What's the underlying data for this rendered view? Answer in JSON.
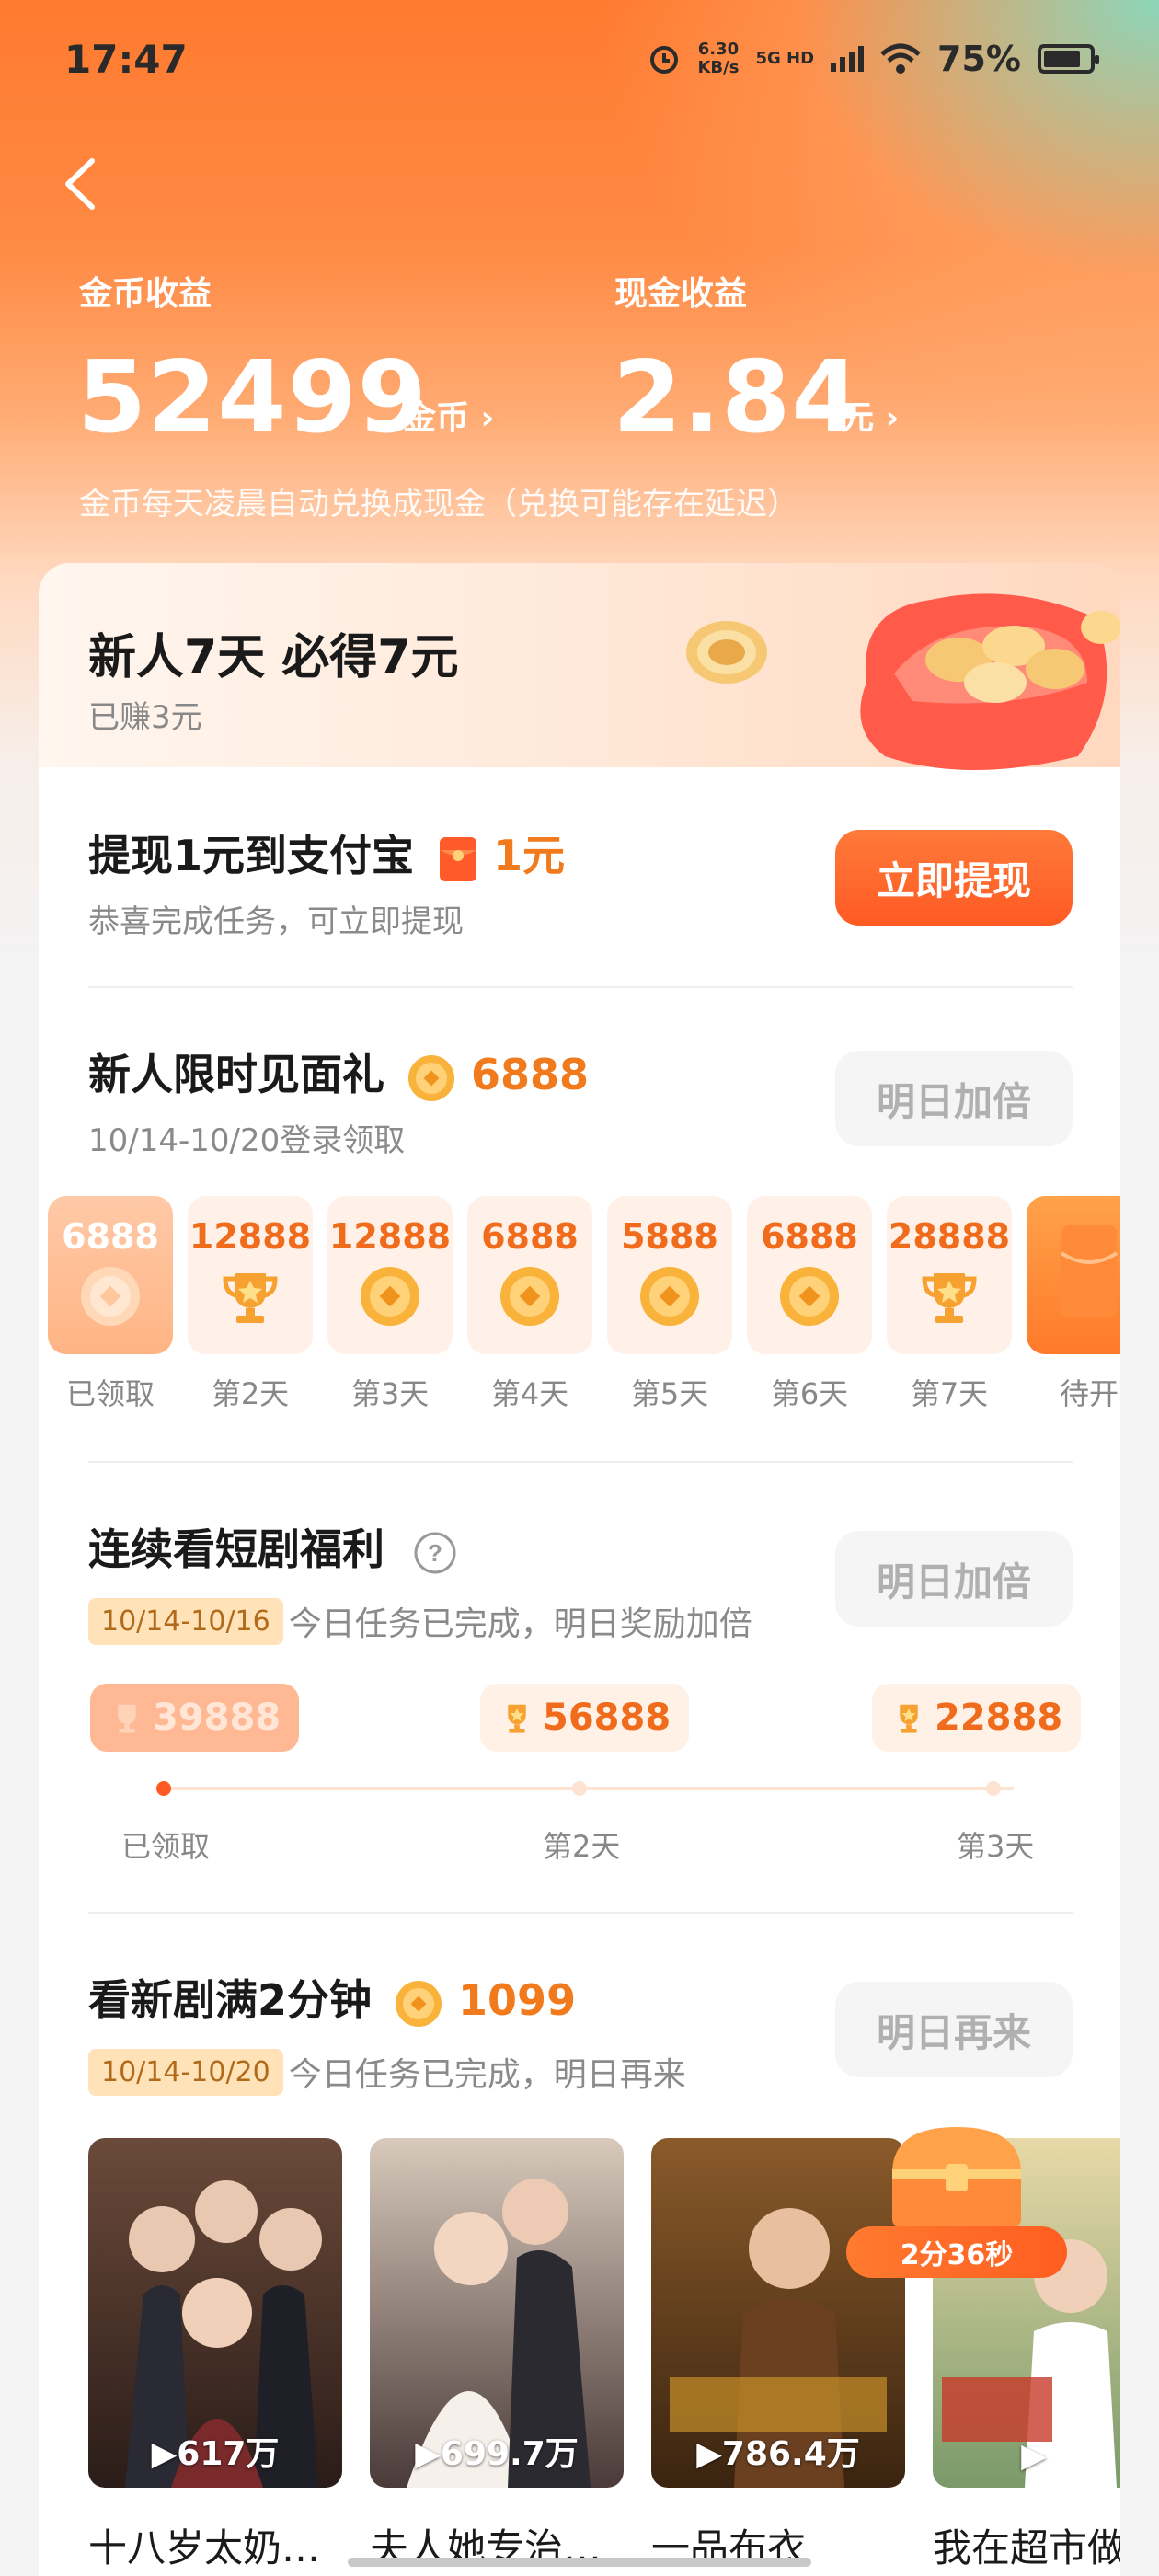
{
  "status_bar": {
    "time": "17:47",
    "speed_value": "6.30",
    "speed_unit": "KB/s",
    "network": "5G HD",
    "battery": "75%"
  },
  "header": {
    "coin_label": "金币收益",
    "coin_value": "52499",
    "coin_unit": "金币 ›",
    "cash_label": "现金收益",
    "cash_value": "2.84",
    "cash_unit": "元 ›",
    "note": "金币每天凌晨自动兑换成现金（兑换可能存在延迟）"
  },
  "banner": {
    "title": "新人7天 必得7元",
    "subtitle": "已赚3元"
  },
  "withdraw": {
    "title": "提现1元到支付宝",
    "amount": "1元",
    "subtitle": "恭喜完成任务，可立即提现",
    "button": "立即提现"
  },
  "gift": {
    "title": "新人限时见面礼",
    "coins": "6888",
    "subtitle": "10/14-10/20登录领取",
    "button": "明日加倍",
    "days": [
      {
        "value": "6888",
        "label": "已领取",
        "icon": "coin-icon",
        "state": "claimed"
      },
      {
        "value": "12888",
        "label": "第2天",
        "icon": "trophy-icon",
        "state": "pending"
      },
      {
        "value": "12888",
        "label": "第3天",
        "icon": "coin-icon",
        "state": "pending"
      },
      {
        "value": "6888",
        "label": "第4天",
        "icon": "coin-icon",
        "state": "pending"
      },
      {
        "value": "5888",
        "label": "第5天",
        "icon": "coin-icon",
        "state": "pending"
      },
      {
        "value": "6888",
        "label": "第6天",
        "icon": "coin-icon",
        "state": "pending"
      },
      {
        "value": "28888",
        "label": "第7天",
        "icon": "trophy-icon",
        "state": "pending"
      },
      {
        "value": "",
        "label": "待开",
        "icon": "red-packet-icon",
        "state": "locked"
      }
    ]
  },
  "streak": {
    "title": "连续看短剧福利",
    "date_tag": "10/14-10/16",
    "desc": "今日任务已完成，明日奖励加倍",
    "button": "明日加倍",
    "steps": [
      {
        "value": "39888",
        "label": "已领取"
      },
      {
        "value": "56888",
        "label": "第2天"
      },
      {
        "value": "22888",
        "label": "第3天"
      }
    ]
  },
  "watch": {
    "title": "看新剧满2分钟",
    "coins": "1099",
    "date_tag": "10/14-10/20",
    "desc": "今日任务已完成，明日再来",
    "button": "明日再来",
    "timer": "2分36秒",
    "dramas": [
      {
        "title": "十八岁太奶…",
        "views": "▶617万",
        "color_top": "#6b4a3a",
        "color_bottom": "#2a1c18"
      },
      {
        "title": "夫人她专治…",
        "views": "▶699.7万",
        "color_top": "#d8c9bc",
        "color_bottom": "#4a3a38"
      },
      {
        "title": "一品布衣",
        "views": "▶786.4万",
        "color_top": "#8a5a2a",
        "color_bottom": "#3a2410"
      },
      {
        "title": "我在超市做",
        "views": "▶",
        "color_top": "#e8d9a8",
        "color_bottom": "#7a9a6a"
      }
    ]
  }
}
